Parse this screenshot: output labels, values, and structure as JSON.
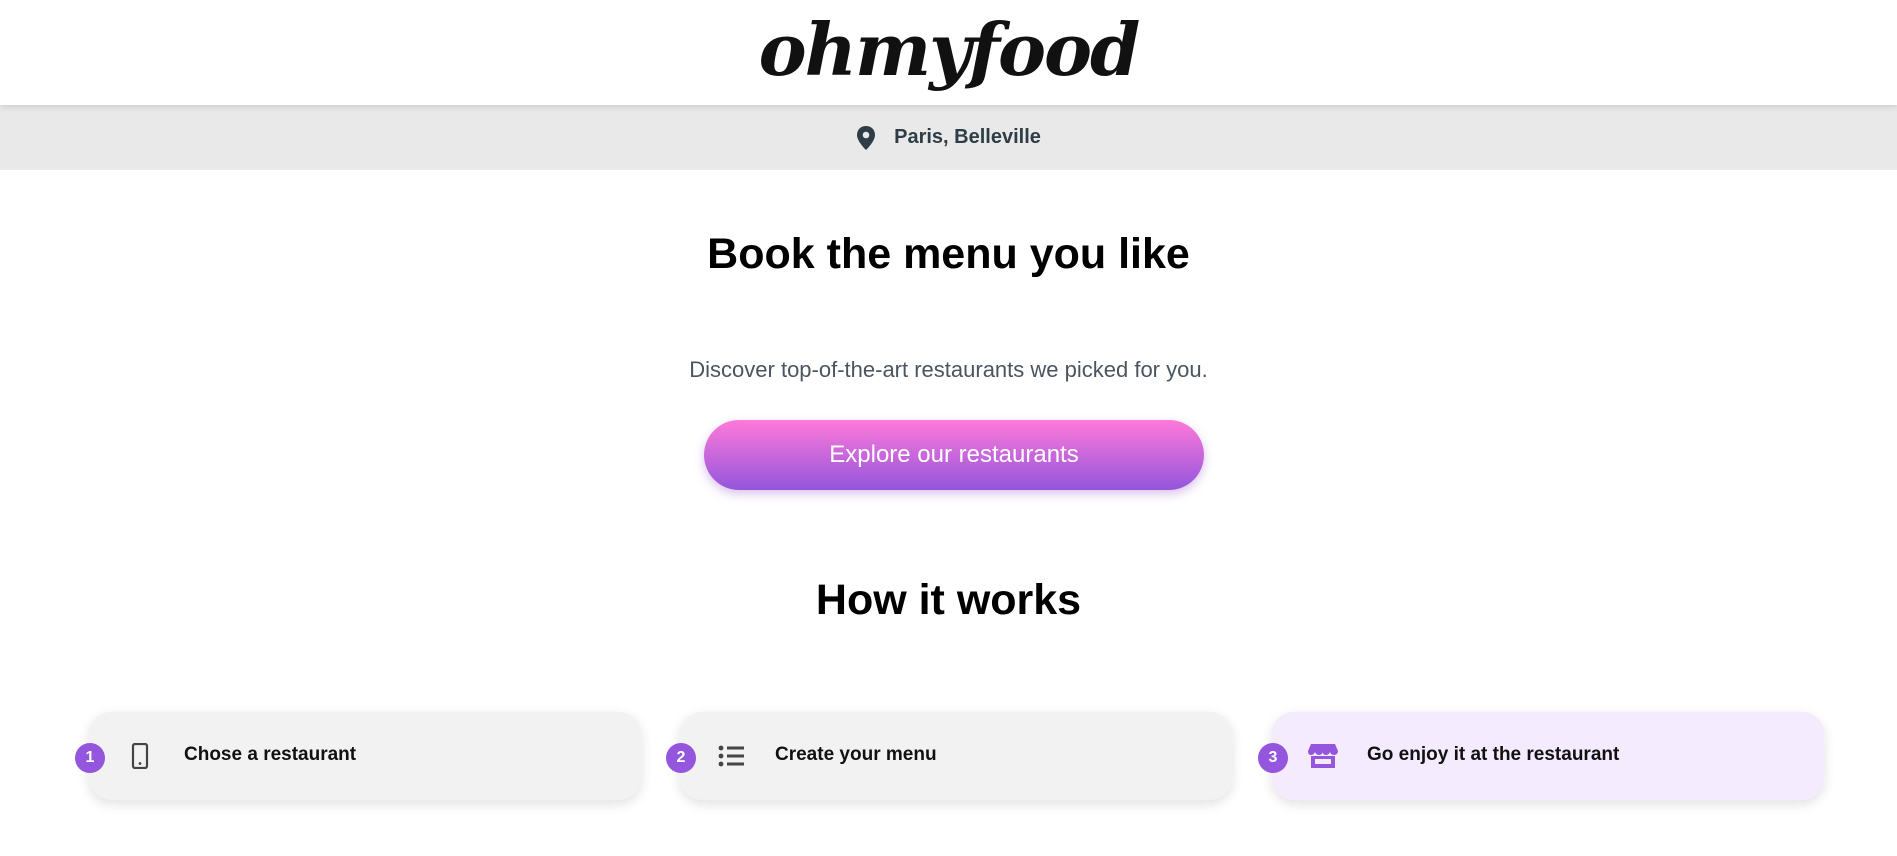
{
  "header": {
    "logo": "ohmyfood"
  },
  "location": {
    "icon": "map-pin-icon",
    "text": "Paris, Belleville"
  },
  "hero": {
    "title": "Book the menu you like",
    "subtitle": "Discover top-of-the-art restaurants we picked for you.",
    "cta_label": "Explore our restaurants"
  },
  "how_it_works": {
    "title": "How it works",
    "steps": [
      {
        "number": "1",
        "icon": "phone-icon",
        "label": "Chose a restaurant"
      },
      {
        "number": "2",
        "icon": "list-icon",
        "label": "Create your menu"
      },
      {
        "number": "3",
        "icon": "store-icon",
        "label": "Go enjoy it at the restaurant"
      }
    ]
  },
  "colors": {
    "accent_purple": "#9356dc",
    "accent_pink": "#ff79da",
    "highlight_bg": "#f4ebff",
    "location_bar_bg": "#e9e9e9"
  }
}
